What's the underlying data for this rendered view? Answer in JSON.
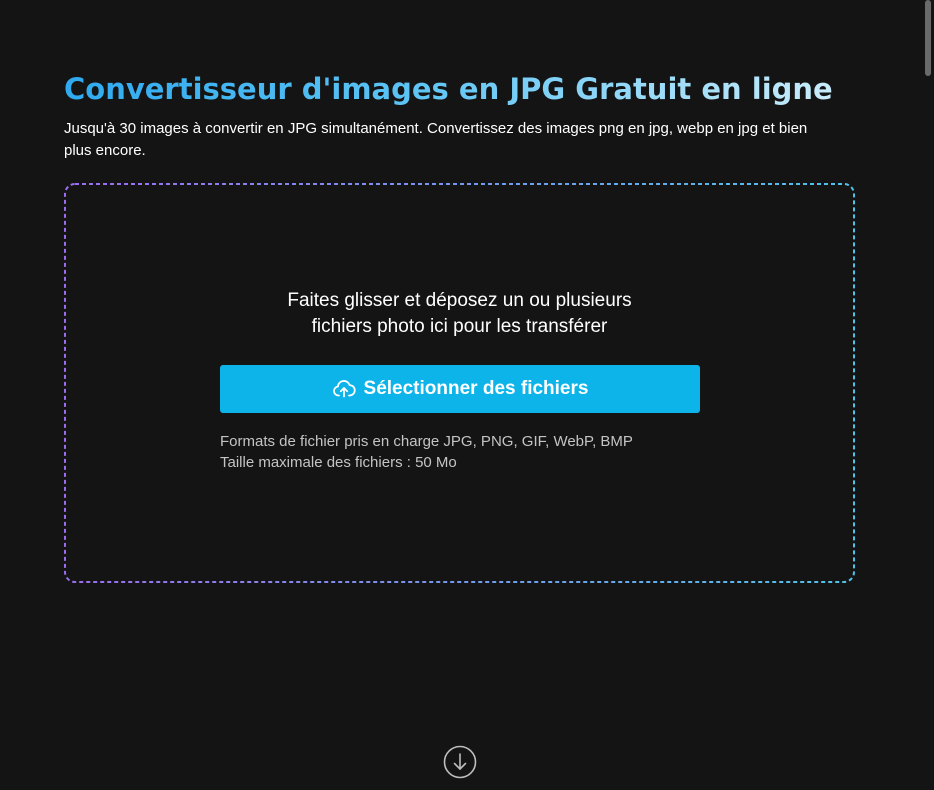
{
  "header": {
    "title": "Convertisseur d'images en JPG Gratuit en ligne",
    "subtitle": "Jusqu'à 30 images à convertir en JPG simultanément. Convertissez des images png en jpg, webp en jpg et bien plus encore."
  },
  "dropzone": {
    "instruction_line1": "Faites glisser et déposez un ou plusieurs",
    "instruction_line2": "fichiers photo ici pour les transférer",
    "button_label": "Sélectionner des fichiers",
    "button_icon": "cloud-upload-icon",
    "formats_text": "Formats de fichier pris en charge JPG, PNG, GIF, WebP, BMP",
    "max_size_text": "Taille maximale des fichiers : 50 Mo"
  },
  "scroll_down_icon": "arrow-down-circle-icon",
  "colors": {
    "background": "#141414",
    "accent": "#0db4ea",
    "title_gradient_start": "#2fa9ef",
    "title_gradient_end": "#c8ecfb",
    "border_gradient_start": "#9b6cf0",
    "border_gradient_end": "#4ec3ea",
    "muted_text": "#c4c4c4"
  }
}
